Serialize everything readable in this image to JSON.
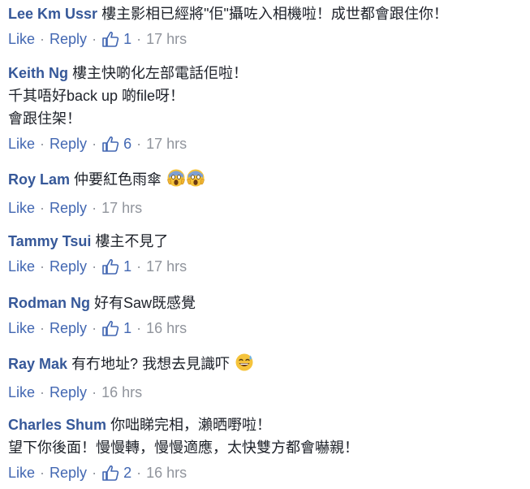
{
  "comments": [
    {
      "author": "Lee Km Ussr",
      "lines": [
        "樓主影相已經將\"佢\"攝咗入相機啦！成世都會跟住你！"
      ],
      "like_label": "Like",
      "reply_label": "Reply",
      "like_count": "1",
      "time": "17 hrs"
    },
    {
      "author": "Keith Ng",
      "lines": [
        "樓主快啲化左部電話佢啦！",
        "千其唔好back up 啲file呀！",
        "會跟住架！"
      ],
      "like_label": "Like",
      "reply_label": "Reply",
      "like_count": "6",
      "time": "17 hrs"
    },
    {
      "author": "Roy Lam",
      "lines": [
        "仲要紅色雨傘"
      ],
      "emoji": "scream-emoji",
      "like_label": "Like",
      "reply_label": "Reply",
      "time": "17 hrs"
    },
    {
      "author": "Tammy Tsui",
      "lines": [
        "樓主不見了"
      ],
      "like_label": "Like",
      "reply_label": "Reply",
      "like_count": "1",
      "time": "17 hrs"
    },
    {
      "author": "Rodman Ng",
      "lines": [
        "好有Saw既感覺"
      ],
      "like_label": "Like",
      "reply_label": "Reply",
      "like_count": "1",
      "time": "16 hrs"
    },
    {
      "author": "Ray Mak",
      "lines": [
        "有冇地址? 我想去見識吓"
      ],
      "emoji": "sweat-smile-emoji",
      "like_label": "Like",
      "reply_label": "Reply",
      "time": "16 hrs"
    },
    {
      "author": "Charles Shum",
      "lines": [
        "你咄睇完相，瀨晒嘢啦！",
        "望下你後面！慢慢轉，慢慢適應，太快雙方都會嚇親！"
      ],
      "like_label": "Like",
      "reply_label": "Reply",
      "like_count": "2",
      "time": "16 hrs"
    }
  ],
  "colors": {
    "author": "#365899",
    "link": "#4267b2",
    "meta": "#90949c",
    "text": "#1d2129"
  },
  "icons": {
    "like_count": "thumbs-up-icon"
  }
}
